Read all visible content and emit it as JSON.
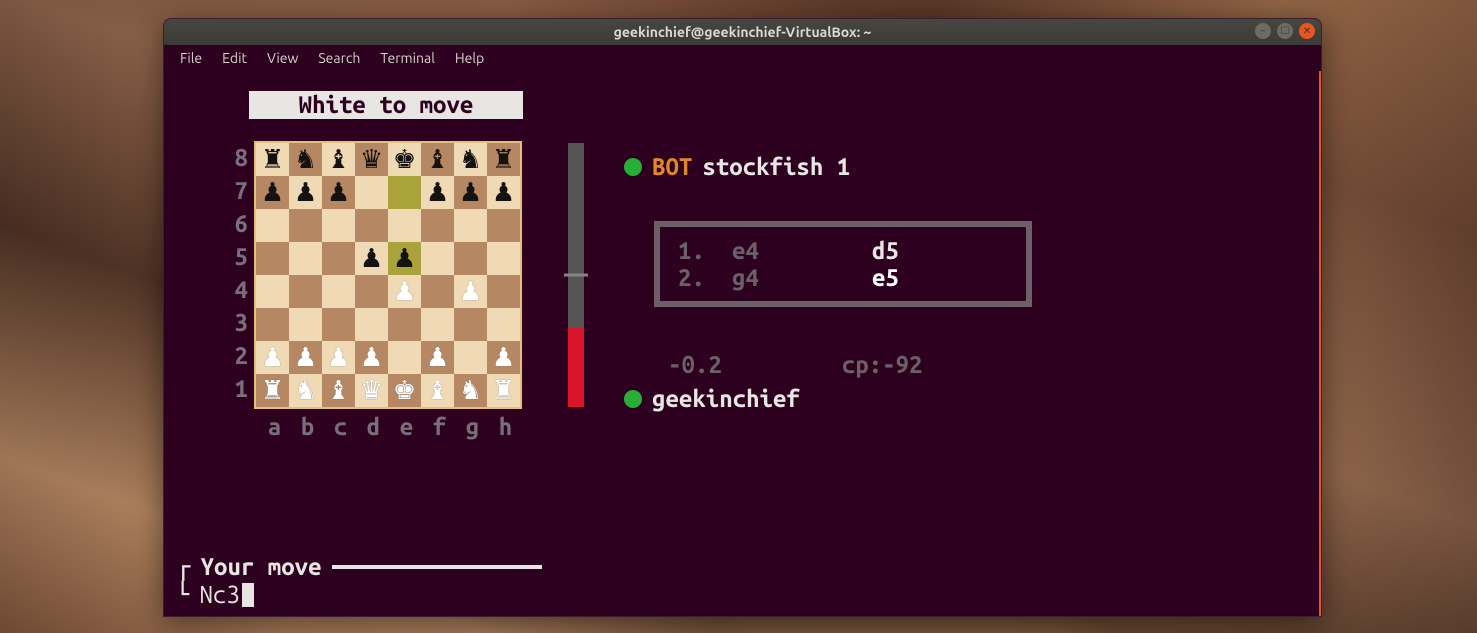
{
  "window": {
    "title": "geekinchief@geekinchief-VirtualBox: ~"
  },
  "menubar": [
    "File",
    "Edit",
    "View",
    "Search",
    "Terminal",
    "Help"
  ],
  "game": {
    "turn_label": "White to move",
    "ranks": [
      "8",
      "7",
      "6",
      "5",
      "4",
      "3",
      "2",
      "1"
    ],
    "files": [
      "a",
      "b",
      "c",
      "d",
      "e",
      "f",
      "g",
      "h"
    ],
    "opponent": {
      "bot_label": "BOT",
      "name": "stockfish 1"
    },
    "self": {
      "name": "geekinchief"
    },
    "moves": [
      {
        "n": "1.",
        "white": "e4",
        "black": "d5"
      },
      {
        "n": "2.",
        "white": "g4",
        "black": "e5"
      }
    ],
    "eval_human": "-0.2",
    "eval_cp_label": "cp:-92",
    "eval_red_fraction": 0.3,
    "board": [
      [
        {
          "p": "r",
          "c": "b"
        },
        {
          "p": "n",
          "c": "b"
        },
        {
          "p": "b",
          "c": "b"
        },
        {
          "p": "q",
          "c": "b"
        },
        {
          "p": "k",
          "c": "b"
        },
        {
          "p": "b",
          "c": "b"
        },
        {
          "p": "n",
          "c": "b"
        },
        {
          "p": "r",
          "c": "b"
        }
      ],
      [
        {
          "p": "p",
          "c": "b"
        },
        {
          "p": "p",
          "c": "b"
        },
        {
          "p": "p",
          "c": "b"
        },
        null,
        {
          "hl": true
        },
        {
          "p": "p",
          "c": "b"
        },
        {
          "p": "p",
          "c": "b"
        },
        {
          "p": "p",
          "c": "b"
        }
      ],
      [
        null,
        null,
        null,
        null,
        null,
        null,
        null,
        null
      ],
      [
        null,
        null,
        null,
        {
          "p": "p",
          "c": "b"
        },
        {
          "p": "p",
          "c": "b",
          "hl": true
        },
        null,
        null,
        null
      ],
      [
        null,
        null,
        null,
        null,
        {
          "p": "p",
          "c": "w"
        },
        null,
        {
          "p": "p",
          "c": "w"
        },
        null
      ],
      [
        null,
        null,
        null,
        null,
        null,
        null,
        null,
        null
      ],
      [
        {
          "p": "p",
          "c": "w"
        },
        {
          "p": "p",
          "c": "w"
        },
        {
          "p": "p",
          "c": "w"
        },
        {
          "p": "p",
          "c": "w"
        },
        null,
        {
          "p": "p",
          "c": "w"
        },
        null,
        {
          "p": "p",
          "c": "w"
        }
      ],
      [
        {
          "p": "r",
          "c": "w"
        },
        {
          "p": "n",
          "c": "w"
        },
        {
          "p": "b",
          "c": "w"
        },
        {
          "p": "q",
          "c": "w"
        },
        {
          "p": "k",
          "c": "w"
        },
        {
          "p": "b",
          "c": "w"
        },
        {
          "p": "n",
          "c": "w"
        },
        {
          "p": "r",
          "c": "w"
        }
      ]
    ]
  },
  "prompt": {
    "label": "Your move",
    "input": "Nc3"
  }
}
